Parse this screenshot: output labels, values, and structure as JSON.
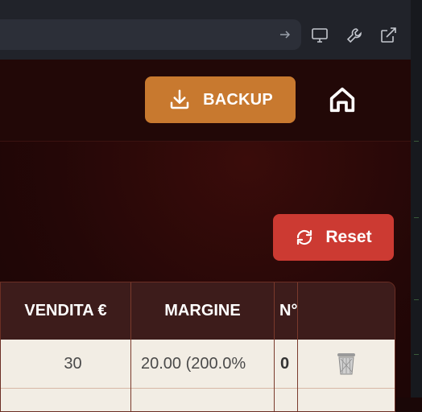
{
  "toolbar": {
    "url_arrow_icon": "arrow-right-icon",
    "icons": [
      "monitor-icon",
      "wrench-icon",
      "external-link-icon"
    ]
  },
  "header": {
    "backup_label": "BACKUP",
    "backup_icon": "download-icon",
    "home_icon": "home-icon",
    "backup_color": "#c8792f"
  },
  "actions": {
    "reset_label": "Reset",
    "reset_icon": "refresh-icon",
    "reset_color": "#cc3a32"
  },
  "table": {
    "columns": [
      "VENDITA €",
      "MARGINE",
      "N°",
      ""
    ],
    "rows": [
      {
        "vendita": "30",
        "margine": "20.00 (200.0%",
        "n": "0",
        "action_icon": "trash-icon"
      }
    ]
  }
}
